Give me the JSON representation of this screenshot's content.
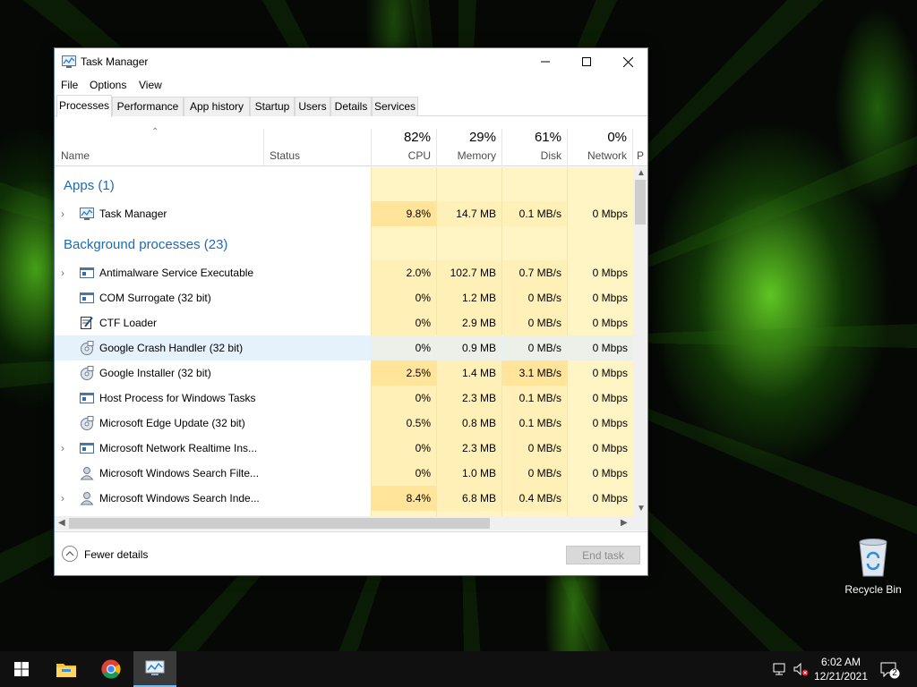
{
  "desktop": {
    "recycle_bin_label": "Recycle Bin"
  },
  "window": {
    "title": "Task Manager",
    "menu": [
      "File",
      "Options",
      "View"
    ],
    "tabs": [
      "Processes",
      "Performance",
      "App history",
      "Startup",
      "Users",
      "Details",
      "Services"
    ],
    "active_tab": "Processes"
  },
  "columns": {
    "name": "Name",
    "status": "Status",
    "cpu": {
      "percent": "82%",
      "label": "CPU"
    },
    "memory": {
      "percent": "29%",
      "label": "Memory"
    },
    "disk": {
      "percent": "61%",
      "label": "Disk"
    },
    "network": {
      "percent": "0%",
      "label": "Network"
    },
    "power_partial": "P"
  },
  "groups": {
    "apps": "Apps (1)",
    "background": "Background processes (23)"
  },
  "apps": [
    {
      "name": "Task Manager",
      "cpu": "9.8%",
      "memory": "14.7 MB",
      "disk": "0.1 MB/s",
      "network": "0 Mbps",
      "expandable": true,
      "icon": "task-manager-icon"
    }
  ],
  "background": [
    {
      "name": "Antimalware Service Executable",
      "cpu": "2.0%",
      "memory": "102.7 MB",
      "disk": "0.7 MB/s",
      "network": "0 Mbps",
      "expandable": true,
      "icon": "service-window-icon"
    },
    {
      "name": "COM Surrogate (32 bit)",
      "cpu": "0%",
      "memory": "1.2 MB",
      "disk": "0 MB/s",
      "network": "0 Mbps",
      "expandable": false,
      "icon": "service-window-icon"
    },
    {
      "name": "CTF Loader",
      "cpu": "0%",
      "memory": "2.9 MB",
      "disk": "0 MB/s",
      "network": "0 Mbps",
      "expandable": false,
      "icon": "notepad-pen-icon"
    },
    {
      "name": "Google Crash Handler (32 bit)",
      "cpu": "0%",
      "memory": "0.9 MB",
      "disk": "0 MB/s",
      "network": "0 Mbps",
      "expandable": false,
      "icon": "installer-disc-icon",
      "selected": true
    },
    {
      "name": "Google Installer (32 bit)",
      "cpu": "2.5%",
      "memory": "1.4 MB",
      "disk": "3.1 MB/s",
      "network": "0 Mbps",
      "expandable": false,
      "icon": "installer-disc-icon"
    },
    {
      "name": "Host Process for Windows Tasks",
      "cpu": "0%",
      "memory": "2.3 MB",
      "disk": "0.1 MB/s",
      "network": "0 Mbps",
      "expandable": false,
      "icon": "service-window-icon"
    },
    {
      "name": "Microsoft Edge Update (32 bit)",
      "cpu": "0.5%",
      "memory": "0.8 MB",
      "disk": "0.1 MB/s",
      "network": "0 Mbps",
      "expandable": false,
      "icon": "installer-disc-icon"
    },
    {
      "name": "Microsoft Network Realtime Ins...",
      "cpu": "0%",
      "memory": "2.3 MB",
      "disk": "0 MB/s",
      "network": "0 Mbps",
      "expandable": true,
      "icon": "service-window-icon"
    },
    {
      "name": "Microsoft Windows Search Filte...",
      "cpu": "0%",
      "memory": "1.0 MB",
      "disk": "0 MB/s",
      "network": "0 Mbps",
      "expandable": false,
      "icon": "search-user-icon"
    },
    {
      "name": "Microsoft Windows Search Inde...",
      "cpu": "8.4%",
      "memory": "6.8 MB",
      "disk": "0.4 MB/s",
      "network": "0 Mbps",
      "expandable": true,
      "icon": "search-user-icon"
    }
  ],
  "footer": {
    "fewer_details": "Fewer details",
    "end_task": "End task"
  },
  "taskbar": {
    "time": "6:02 AM",
    "date": "12/21/2021",
    "notification_count": "2"
  }
}
